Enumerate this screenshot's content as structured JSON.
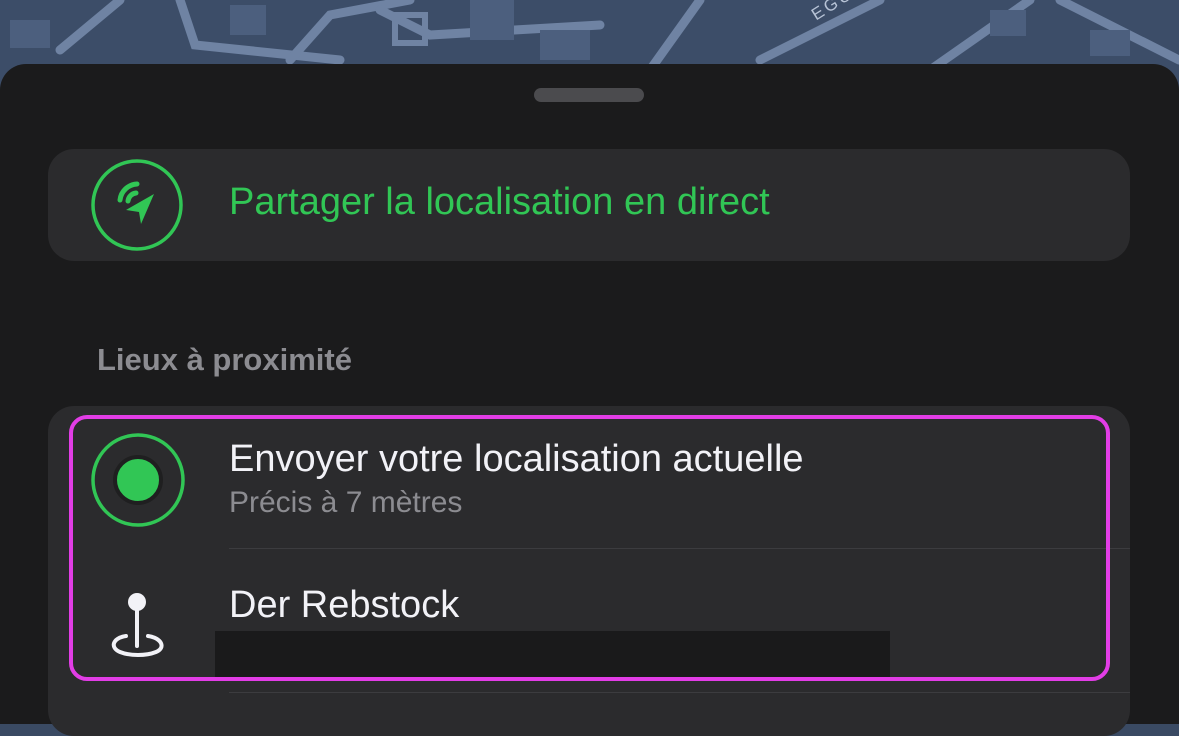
{
  "map": {
    "street_label": "EGUIBAL",
    "background_color": "#3c4d68",
    "road_color": "#6f83a3"
  },
  "sheet": {
    "share_action": {
      "label": "Partager la localisation en direct",
      "icon": "live-location-share-icon",
      "accent_color": "#31c655"
    },
    "nearby_section": {
      "title": "Lieux à proximité",
      "items": [
        {
          "title": "Envoyer votre localisation actuelle",
          "subtitle": "Précis à 7 mètres",
          "icon": "current-location-icon"
        },
        {
          "title": "Der Rebstock",
          "subtitle": "",
          "icon": "location-pin-icon",
          "subtitle_redacted": true
        }
      ]
    }
  },
  "annotation": {
    "highlight_color": "#e23de6"
  }
}
